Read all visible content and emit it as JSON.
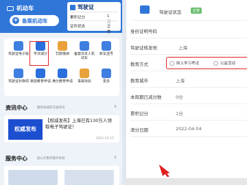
{
  "left": {
    "header": {
      "tab_label": "机动车",
      "add_vehicle_label": "备案机动车"
    },
    "license_card": {
      "title": "驾驶证",
      "rows": [
        {
          "label": "累积记分",
          "value": "1分"
        },
        {
          "label": "证件状态",
          "value": "正常"
        }
      ]
    },
    "services": [
      {
        "label": "驾驶证电子版",
        "icon": "license-icon",
        "color": "#3f7fe0"
      },
      {
        "label": "学法减分",
        "icon": "study-icon",
        "color": "#2a6fdc"
      },
      {
        "label": "罚款缴纳",
        "icon": "fine-icon",
        "color": "#e9a23a"
      },
      {
        "label": "备案非本人机动车",
        "icon": "car-file-icon",
        "color": "#3f7fe0"
      },
      {
        "label": "新车选号",
        "icon": "plate-icon",
        "color": "#3f7fe0"
      },
      {
        "label": "驾驶证补换领",
        "icon": "renew-icon",
        "color": "#3f7fe0"
      },
      {
        "label": "审验教育申请",
        "icon": "edu-icon",
        "color": "#2a6fdc"
      },
      {
        "label": "满分教育申请",
        "icon": "score-icon",
        "color": "#2a6fdc"
      },
      {
        "label": "事故快处",
        "icon": "accident-icon",
        "color": "#e9a23a"
      },
      {
        "label": "更多",
        "icon": "more-icon",
        "color": "#3f7fe0"
      }
    ],
    "news": {
      "title": "资讯中心",
      "subtitle": "最新权威的交通资讯",
      "thumb_text": "权威发布",
      "headline": "【权威发布】上海已有130万人领取电子驾驶证！",
      "date": "2021-12-15"
    },
    "service_center": {
      "title": "服务中心",
      "subtitle": "贴心灯服务服务体验"
    }
  },
  "right": {
    "status_row": {
      "label": "驾驶证状态",
      "tag": "正常"
    },
    "rows": [
      {
        "label": "身份证明号码",
        "value": ""
      },
      {
        "label": "驾驶证核发地",
        "value": "上海"
      },
      {
        "label": "教育方式",
        "value": ""
      },
      {
        "label": "教育城市",
        "value": "上海"
      },
      {
        "label": "本周期已减分数",
        "value": "0分"
      },
      {
        "label": "累积记分",
        "value": "1分"
      },
      {
        "label": "清分日期",
        "value": "2022-04-04"
      }
    ],
    "education_options": [
      "网上学习考试",
      "公益活动"
    ]
  },
  "colors": {
    "primary": "#2f76d8",
    "highlight": "#e02020",
    "status_green": "#6cc070"
  }
}
